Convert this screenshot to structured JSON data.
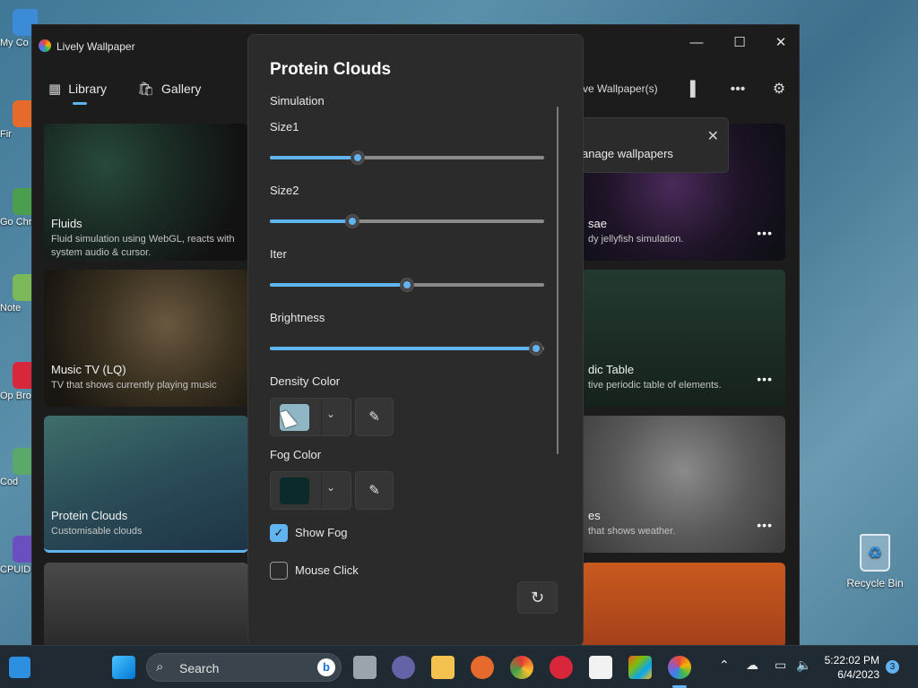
{
  "colors": {
    "accent": "#60b4f0",
    "window_bg": "#1c1c1c",
    "panel_bg": "#2b2b2b"
  },
  "desktop": {
    "icons": [
      {
        "label": "My Co",
        "color": "#3c8bd8"
      },
      {
        "label": "Fir",
        "color": "#e66a2c"
      },
      {
        "label": "Go Chr",
        "color": "#4a9e4e"
      },
      {
        "label": "Note",
        "color": "#7bb85a"
      },
      {
        "label": "Op Bro",
        "color": "#d8263a"
      },
      {
        "label": "Cod",
        "color": "#5aa96a"
      },
      {
        "label": "CPUID",
        "color": "#6a4fc0"
      }
    ],
    "recycle_bin": "Recycle Bin"
  },
  "window": {
    "title": "Lively Wallpaper",
    "controls": {
      "minimize": "—",
      "maximize": "☐",
      "close": "✕"
    },
    "nav": [
      {
        "label": "Library",
        "icon": "grid-icon"
      },
      {
        "label": "Gallery",
        "icon": "bag-icon"
      }
    ],
    "header_text": "ve Wallpaper(s)",
    "tooltip": {
      "text": "anage wallpapers"
    },
    "cards": [
      {
        "name": "Fluids",
        "desc": "Fluid simulation using WebGL, reacts with system audio & cursor."
      },
      {
        "name": "Music TV (LQ)",
        "desc": "TV that shows currently playing music"
      },
      {
        "name": "Protein Clouds",
        "desc": "Customisable clouds"
      },
      {
        "name": "",
        "desc": ""
      },
      {
        "name": "sae",
        "desc": "dy jellyfish simulation."
      },
      {
        "name": "dic Table",
        "desc": "tive periodic table of elements."
      },
      {
        "name": "es",
        "desc": "that shows weather."
      },
      {
        "name": "",
        "desc": ""
      }
    ]
  },
  "panel": {
    "title": "Protein Clouds",
    "section": "Simulation",
    "sliders": [
      {
        "label": "Size1",
        "value": 0.32
      },
      {
        "label": "Size2",
        "value": 0.3
      },
      {
        "label": "Iter",
        "value": 0.5
      },
      {
        "label": "Brightness",
        "value": 0.97
      }
    ],
    "colors": [
      {
        "label": "Density Color",
        "swatch": "#8fb6c4"
      },
      {
        "label": "Fog Color",
        "swatch": "#0d2a2a"
      }
    ],
    "checkboxes": [
      {
        "label": "Show Fog",
        "checked": true
      },
      {
        "label": "Mouse Click",
        "checked": false
      }
    ]
  },
  "taskbar": {
    "search_placeholder": "Search",
    "time": "5:22:02 PM",
    "date": "6/4/2023",
    "notification_count": "3"
  }
}
